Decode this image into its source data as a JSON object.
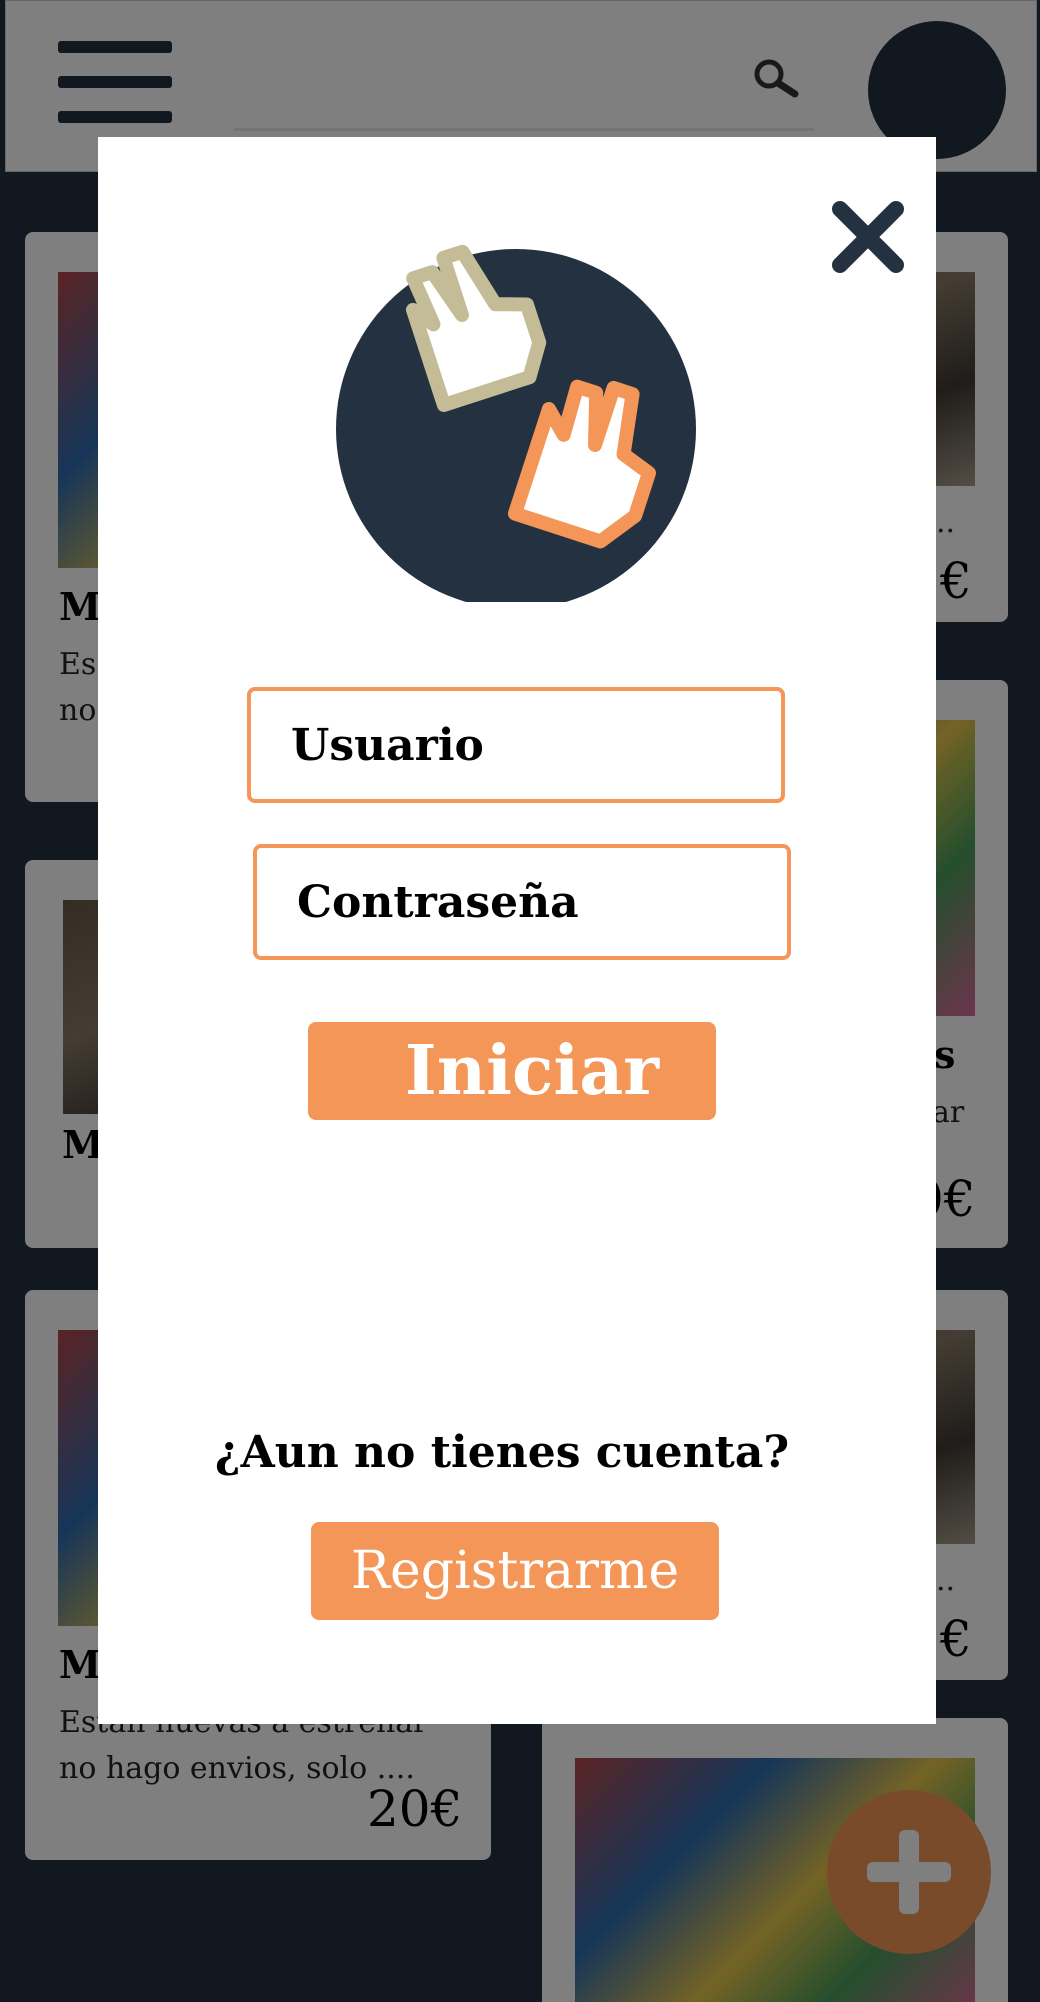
{
  "background": {
    "cards": [
      {
        "title": "M",
        "desc": "Es",
        "desc2": "no",
        "price": ""
      },
      {
        "title": "",
        "desc": "..",
        "price": "€"
      },
      {
        "title": "M",
        "desc": "",
        "price": ""
      },
      {
        "title": "s",
        "desc": "ar",
        "price": "0€"
      },
      {
        "title": "",
        "desc": "..",
        "price": "€"
      },
      {
        "title": "M",
        "desc": "Estan nuevas a estrenar",
        "desc2": "no hago envios, solo ....",
        "price": "20€"
      }
    ]
  },
  "modal": {
    "username_placeholder": "Usuario",
    "password_placeholder": "Contraseña",
    "login_label": "Iniciar",
    "signup_prompt": "¿Aun no tienes cuenta?",
    "register_label": "Registrarme"
  },
  "colors": {
    "accent": "#f39657",
    "navy": "#233140",
    "beige": "#c4bc96"
  },
  "icons": [
    "menu-icon",
    "search-icon",
    "close-icon",
    "peace-hands-logo-icon",
    "plus-icon"
  ]
}
